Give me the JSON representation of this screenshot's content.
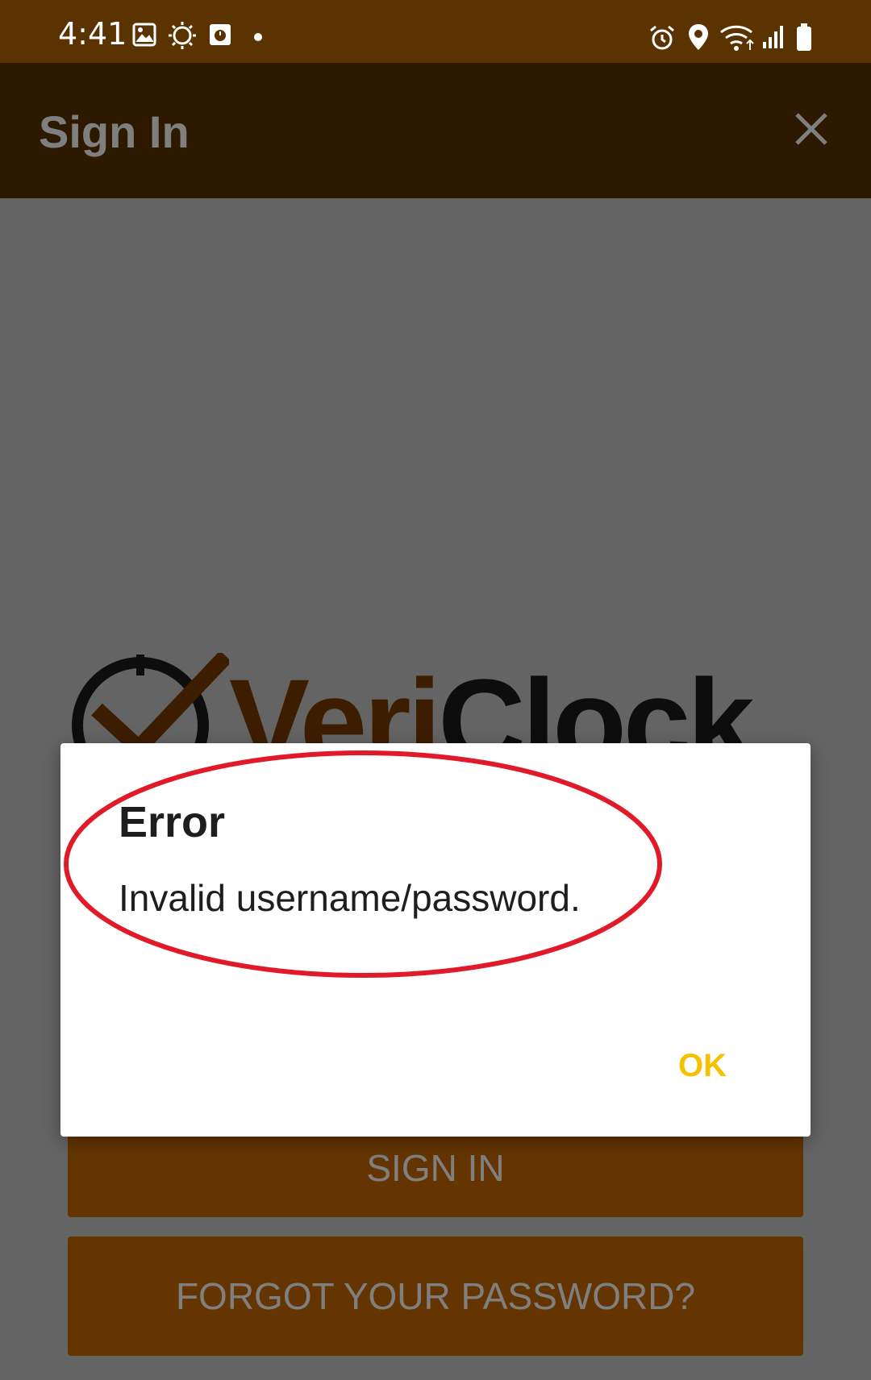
{
  "status_bar": {
    "time": "4:41",
    "icons": [
      "gallery-icon",
      "weather-icon",
      "media-icon",
      "notification-dot-icon",
      "alarm-icon",
      "location-icon",
      "wifi-icon",
      "signal-icon",
      "battery-icon"
    ]
  },
  "app_bar": {
    "title": "Sign In",
    "close_icon": "close-icon"
  },
  "logo": {
    "text_part1": "Veri",
    "text_part2": "Clock"
  },
  "buttons": {
    "sign_in": "SIGN IN",
    "forgot_password": "FORGOT YOUR PASSWORD?"
  },
  "dialog": {
    "title": "Error",
    "message": "Invalid username/password.",
    "ok_label": "OK"
  },
  "colors": {
    "status_bar": "#5a3301",
    "app_bar": "#5a3301",
    "button": "#c86a00",
    "ok_text": "#f5c200",
    "annotation": "#e01a28"
  }
}
